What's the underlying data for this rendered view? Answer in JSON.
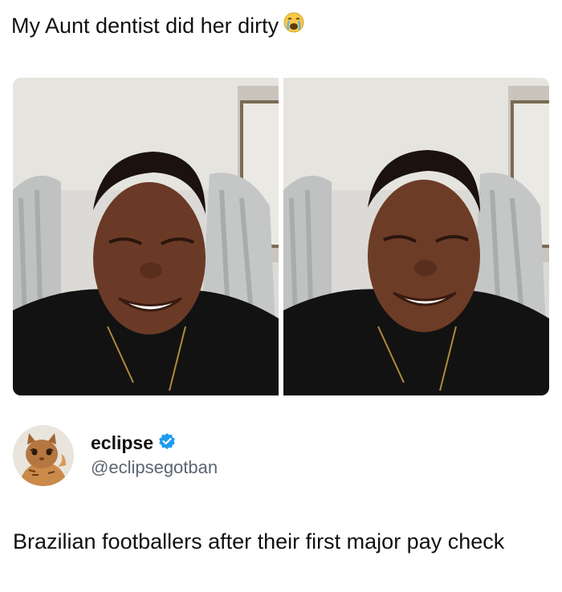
{
  "caption": {
    "text": "My Aunt dentist did her dirty",
    "emoji": "crying-face-icon"
  },
  "photos": {
    "left": "before-selfie-photo",
    "right": "after-selfie-photo"
  },
  "tweet": {
    "display_name": "eclipse",
    "handle": "@eclipsegotban",
    "verified": true,
    "text": "Brazilian footballers after their first major pay check"
  },
  "colors": {
    "verified_badge": "#1d9bf0",
    "handle": "#5b6670",
    "text": "#111111"
  }
}
